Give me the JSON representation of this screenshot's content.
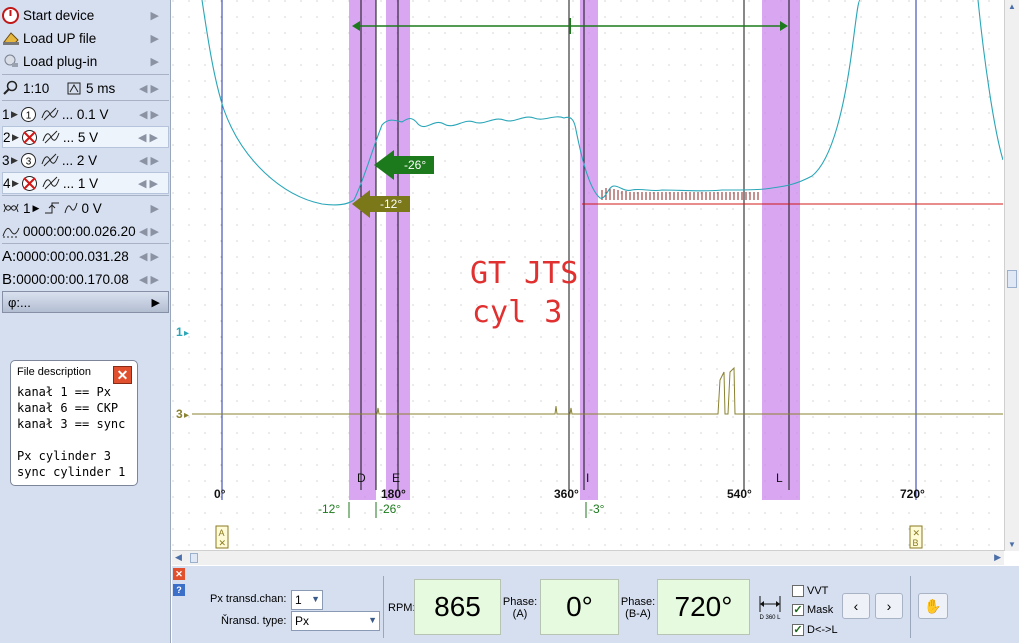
{
  "menu": {
    "start_device": "Start device",
    "load_up_file": "Load UP file",
    "load_plugin": "Load plug-in"
  },
  "zoom": {
    "ratio": "1:10",
    "time": "5 ms"
  },
  "channels": [
    {
      "num": "1",
      "index_icon": "1",
      "range": "... 0.1 V",
      "enabled": true
    },
    {
      "num": "2",
      "index_icon": "x",
      "range": "... 5 V",
      "enabled": false
    },
    {
      "num": "3",
      "index_icon": "3",
      "range": "... 2 V",
      "enabled": true
    },
    {
      "num": "4",
      "index_icon": "x",
      "range": "... 1 V",
      "enabled": false
    }
  ],
  "trigger": {
    "channel": "1",
    "level": "0 V"
  },
  "pretrigger": "0000:00:00.026.20",
  "cursor_a": {
    "label": "A:",
    "time": "0000:00:00.031.28"
  },
  "cursor_b": {
    "label": "B:",
    "time": "0000:00:00.170.08"
  },
  "phi": {
    "label": "φ:..."
  },
  "file_description": {
    "title": "File description",
    "lines": [
      "kanał 1 == Px",
      "kanał 6 == CKP",
      "kanał 3 == sync",
      "",
      "Px cylinder 3",
      "sync cylinder 1"
    ]
  },
  "plot": {
    "annotation_line1": "GT JTS",
    "annotation_line2": "cyl 3",
    "channel_markers": [
      "1",
      "3"
    ],
    "deg_labels": [
      "0°",
      "180°",
      "360°",
      "540°",
      "720°"
    ],
    "markers": [
      "D",
      "E",
      "I",
      "L"
    ],
    "offset_labels": [
      "-12°",
      "-26°",
      "-3°"
    ],
    "arrow_labels": [
      "-26°",
      "-12°"
    ],
    "cursor_labels": [
      "A",
      "B"
    ],
    "colors": {
      "trace1": "#2aa6b8",
      "trace3": "#8a8230",
      "band": "#cc88ee",
      "red_line": "#d01818",
      "green": "#1c7a1c",
      "olive": "#7a7818"
    }
  },
  "bottom": {
    "px_transd_chan_label": "Px transd.chan:",
    "px_transd_chan_value": "1",
    "transd_type_label": "Ňransd. type:",
    "transd_type_value": "Px",
    "rpm_label": "RPM:",
    "rpm_value": "865",
    "phase_a_label": "Phase:",
    "phase_a_sub": "(A)",
    "phase_a_value": "0°",
    "phase_ba_label": "Phase:",
    "phase_ba_sub": "(B-A)",
    "phase_ba_value": "720°",
    "d360_label": "D 360 L",
    "vvt_label": "VVT",
    "vvt_checked": false,
    "mask_label": "Mask",
    "mask_checked": true,
    "dl_label": "D<->L",
    "dl_checked": true,
    "prev_label": "‹",
    "next_label": "›"
  }
}
